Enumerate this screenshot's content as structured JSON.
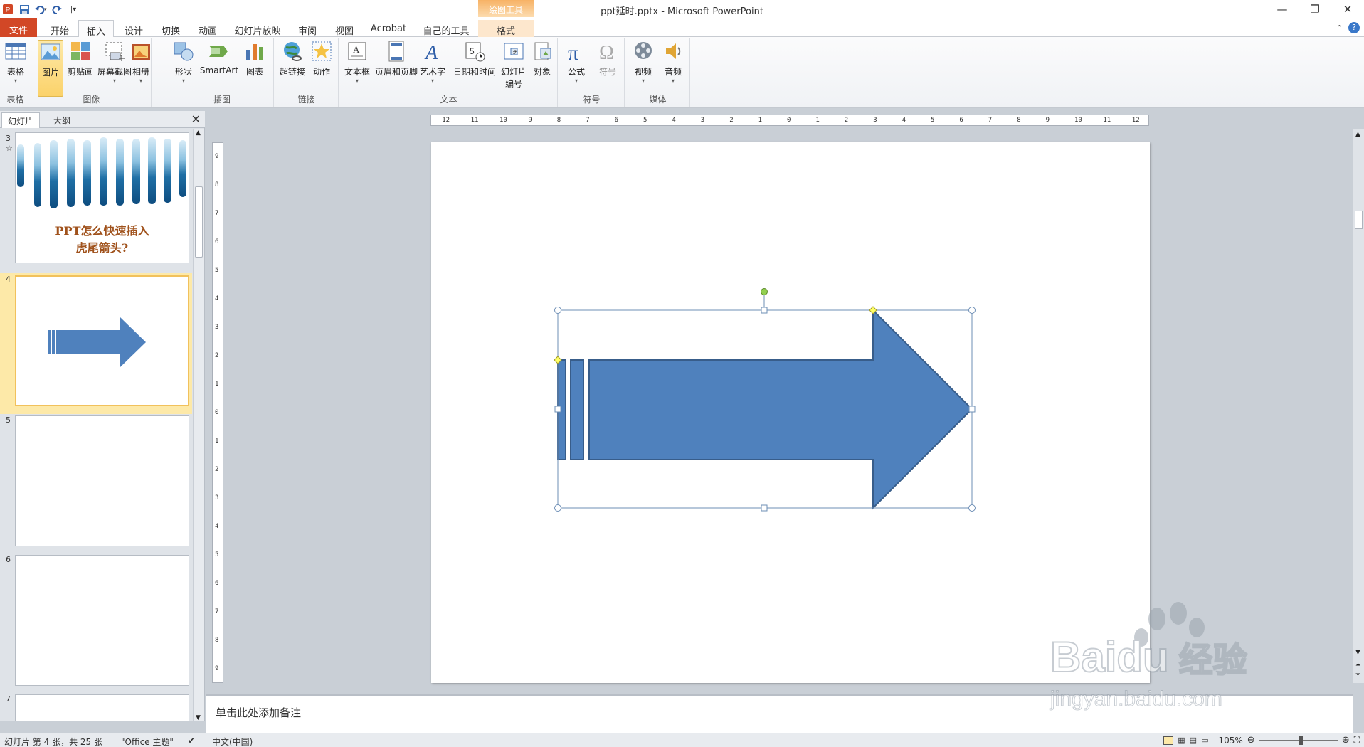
{
  "window": {
    "title": "ppt延时.pptx - Microsoft PowerPoint",
    "context_tab_header": "绘图工具",
    "controls": [
      "—",
      "❐",
      "✕"
    ]
  },
  "quick_access": {
    "app_icon": "powerpoint-icon",
    "items": [
      "save-icon",
      "undo-icon",
      "redo-icon",
      "customize-icon"
    ]
  },
  "tabs": [
    {
      "label": "文件"
    },
    {
      "label": "开始"
    },
    {
      "label": "插入"
    },
    {
      "label": "设计"
    },
    {
      "label": "切换"
    },
    {
      "label": "动画"
    },
    {
      "label": "幻灯片放映"
    },
    {
      "label": "审阅"
    },
    {
      "label": "视图"
    },
    {
      "label": "Acrobat"
    },
    {
      "label": "自己的工具"
    },
    {
      "label": "格式"
    }
  ],
  "active_tab": "插入",
  "ribbon": {
    "groups": {
      "table": {
        "label": "表格",
        "buttons": [
          "表格"
        ]
      },
      "image": {
        "label": "图像",
        "buttons": [
          "图片",
          "剪贴画",
          "屏幕截图",
          "相册"
        ]
      },
      "illustrations": {
        "label": "插图",
        "buttons": [
          "形状",
          "SmartArt",
          "图表"
        ]
      },
      "links": {
        "label": "链接",
        "buttons": [
          "超链接",
          "动作"
        ]
      },
      "text": {
        "label": "文本",
        "buttons": [
          "文本框",
          "页眉和页脚",
          "艺术字",
          "日期和时间",
          "幻灯片",
          "对象"
        ],
        "slide_number_line2": "编号"
      },
      "symbols": {
        "label": "符号",
        "buttons": [
          "公式",
          "符号"
        ]
      },
      "media": {
        "label": "媒体",
        "buttons": [
          "视频",
          "音频"
        ]
      }
    }
  },
  "left_panel": {
    "tabs": [
      "幻灯片",
      "大纲"
    ],
    "close": "✕",
    "thumbnails": [
      {
        "number": "3",
        "extra": "☆",
        "title_line1": "PPT怎么快速插入",
        "title_line2": "虎尾箭头?"
      },
      {
        "number": "4"
      },
      {
        "number": "5"
      },
      {
        "number": "6"
      },
      {
        "number": "7"
      }
    ]
  },
  "ruler": {
    "horizontal": [
      "12",
      "11",
      "10",
      "9",
      "8",
      "7",
      "6",
      "5",
      "4",
      "3",
      "2",
      "1",
      "0",
      "1",
      "2",
      "3",
      "4",
      "5",
      "6",
      "7",
      "8",
      "9",
      "10",
      "11",
      "12"
    ],
    "vertical": [
      "9",
      "8",
      "7",
      "6",
      "5",
      "4",
      "3",
      "2",
      "1",
      "0",
      "1",
      "2",
      "3",
      "4",
      "5",
      "6",
      "7",
      "8",
      "9"
    ]
  },
  "notes": {
    "placeholder": "单击此处添加备注"
  },
  "status": {
    "slide_info": "幻灯片 第 4 张，共 25 张",
    "theme": "\"Office 主题\"",
    "language": "中文(中国)",
    "zoom": "105%"
  },
  "watermark": {
    "brand": "Baidu",
    "cn": "经验",
    "url": "jingyan.baidu.com"
  },
  "colors": {
    "file_tab": "#d24726",
    "arrow_fill": "#4f81bd",
    "arrow_stroke": "#385d8a",
    "selection_handle": "#ffff66",
    "rotate_handle": "#92d050",
    "thumb_title": "#a0521c"
  }
}
